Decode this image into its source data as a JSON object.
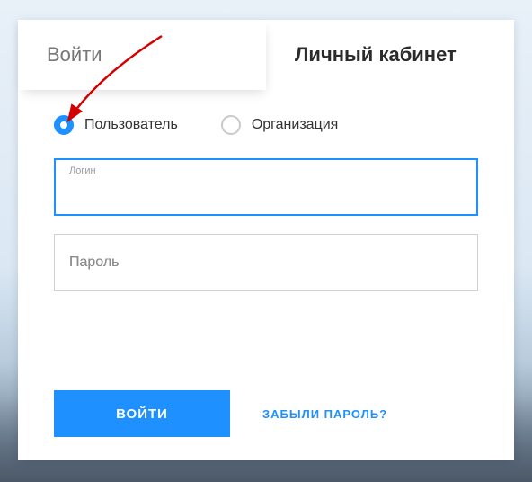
{
  "tabs": {
    "login": "Войти",
    "cabinet": "Личный кабинет"
  },
  "account_type": {
    "user": "Пользователь",
    "org": "Организация"
  },
  "fields": {
    "login_label": "Логин",
    "password_placeholder": "Пароль"
  },
  "actions": {
    "submit": "ВОЙТИ",
    "forgot": "ЗАБЫЛИ ПАРОЛЬ?"
  }
}
